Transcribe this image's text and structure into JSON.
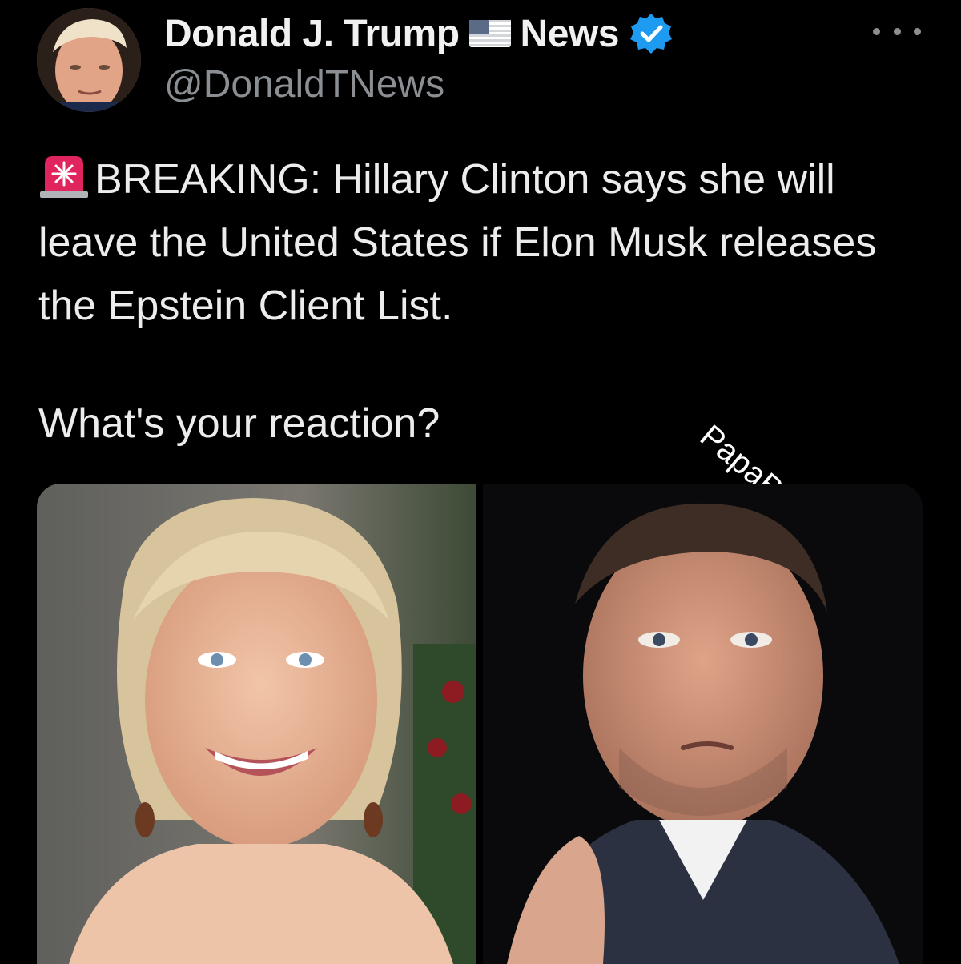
{
  "tweet": {
    "display_name_part1": "Donald J. Trump",
    "display_name_part2": "News",
    "handle": "@DonaldTNews",
    "flag_icon": "us-flag-icon",
    "verified_icon": "verified-badge-icon",
    "more_icon": "more-options-icon",
    "body_icon": "police-siren-icon",
    "body": "BREAKING: Hillary Clinton says she will leave the United States if Elon Musk releases the Epstein Client List.",
    "question": "What's your reaction?"
  },
  "watermark": {
    "text": "PapaBear",
    "icon": "bear-face-icon"
  },
  "media": {
    "images": [
      {
        "icon": "photo-left"
      },
      {
        "icon": "photo-right"
      }
    ]
  },
  "colors": {
    "background": "#000000",
    "text": "#ececec",
    "handle": "#8b8f93",
    "verified": "#1d9bf0",
    "siren": "#e0245e"
  }
}
